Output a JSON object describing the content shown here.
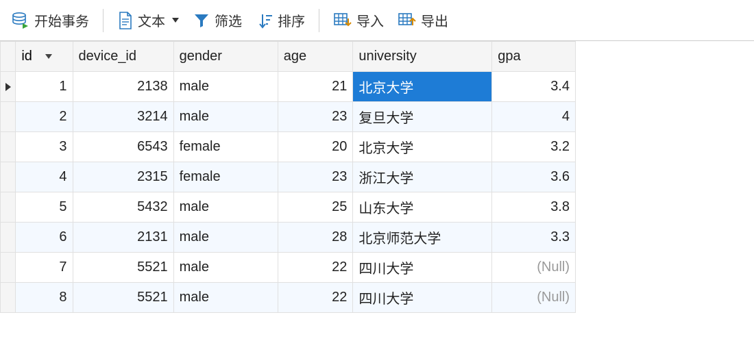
{
  "toolbar": {
    "begin_tx": "开始事务",
    "text": "文本",
    "filter": "筛选",
    "sort": "排序",
    "import": "导入",
    "export": "导出"
  },
  "columns": {
    "id": "id",
    "device_id": "device_id",
    "gender": "gender",
    "age": "age",
    "university": "university",
    "gpa": "gpa"
  },
  "null_label": "(Null)",
  "rows": [
    {
      "id": "1",
      "device_id": "2138",
      "gender": "male",
      "age": "21",
      "university": "北京大学",
      "gpa": "3.4",
      "current": true,
      "selected_col": "university"
    },
    {
      "id": "2",
      "device_id": "3214",
      "gender": "male",
      "age": "23",
      "university": "复旦大学",
      "gpa": "4"
    },
    {
      "id": "3",
      "device_id": "6543",
      "gender": "female",
      "age": "20",
      "university": "北京大学",
      "gpa": "3.2"
    },
    {
      "id": "4",
      "device_id": "2315",
      "gender": "female",
      "age": "23",
      "university": "浙江大学",
      "gpa": "3.6"
    },
    {
      "id": "5",
      "device_id": "5432",
      "gender": "male",
      "age": "25",
      "university": "山东大学",
      "gpa": "3.8"
    },
    {
      "id": "6",
      "device_id": "2131",
      "gender": "male",
      "age": "28",
      "university": "北京师范大学",
      "gpa": "3.3"
    },
    {
      "id": "7",
      "device_id": "5521",
      "gender": "male",
      "age": "22",
      "university": "四川大学",
      "gpa": null
    },
    {
      "id": "8",
      "device_id": "5521",
      "gender": "male",
      "age": "22",
      "university": "四川大学",
      "gpa": null
    }
  ]
}
